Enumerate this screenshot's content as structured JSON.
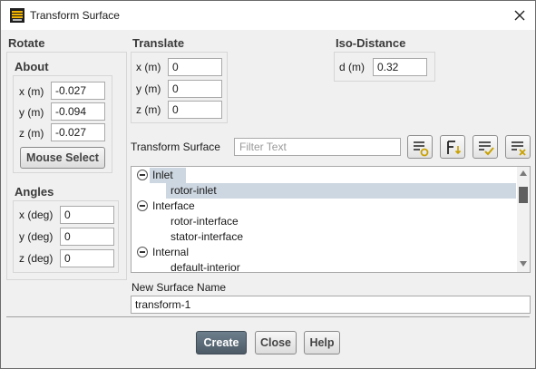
{
  "window": {
    "title": "Transform Surface"
  },
  "rotate": {
    "heading": "Rotate",
    "about": {
      "heading": "About",
      "x_label": "x (m)",
      "x_value": "-0.027",
      "y_label": "y (m)",
      "y_value": "-0.094",
      "z_label": "z (m)",
      "z_value": "-0.027",
      "mouse_select_label": "Mouse Select"
    },
    "angles": {
      "heading": "Angles",
      "x_label": "x (deg)",
      "x_value": "0",
      "y_label": "y (deg)",
      "y_value": "0",
      "z_label": "z (deg)",
      "z_value": "0"
    }
  },
  "translate": {
    "heading": "Translate",
    "x_label": "x (m)",
    "x_value": "0",
    "y_label": "y (m)",
    "y_value": "0",
    "z_label": "z (m)",
    "z_value": "0"
  },
  "iso_distance": {
    "heading": "Iso-Distance",
    "d_label": "d (m)",
    "d_value": "0.32"
  },
  "transform_surface": {
    "label": "Transform Surface",
    "filter_placeholder": "Filter Text",
    "groups": [
      {
        "name": "Inlet",
        "items": [
          "rotor-inlet"
        ]
      },
      {
        "name": "Interface",
        "items": [
          "rotor-interface",
          "stator-interface"
        ]
      },
      {
        "name": "Internal",
        "items": [
          "default-interior"
        ]
      }
    ]
  },
  "new_surface": {
    "label": "New Surface Name",
    "value": "transform-1"
  },
  "actions": {
    "create": "Create",
    "close": "Close",
    "help": "Help"
  },
  "colors": {
    "selection": "#cdd7e1",
    "primary_button": "#56646f",
    "icon_accent": "#c8a000"
  }
}
